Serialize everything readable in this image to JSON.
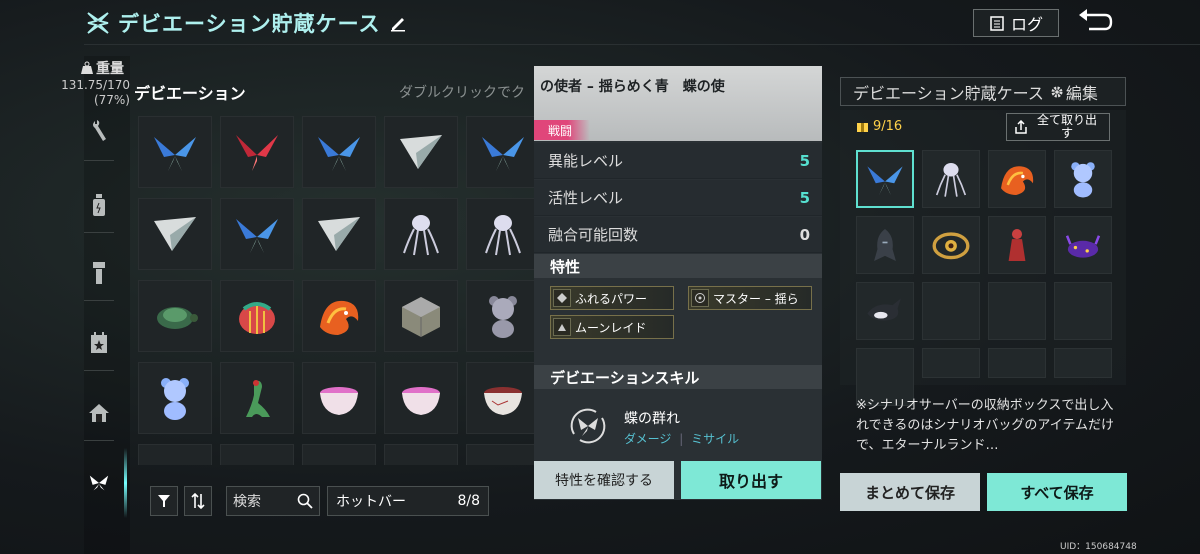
{
  "header": {
    "title": "デビエーション貯蔵ケース",
    "log_label": "ログ"
  },
  "sidebar": {
    "weight_label": "重量",
    "weight_value": "131.75/170",
    "weight_percent": "(77%)"
  },
  "inventory": {
    "section_title": "デビエーション",
    "hint": "ダブルクリックでク",
    "items": [
      "butterfly-blue",
      "butterfly-red",
      "butterfly-blue",
      "paper-plane",
      "butterfly-blue",
      "paper-plane",
      "butterfly-blue",
      "paper-plane",
      "jellyfish",
      "jellyfish",
      "turtle",
      "pumpkin-pot",
      "fire-dragon",
      "cube",
      "teddy-gray",
      "teddy-blue",
      "lizard",
      "bowl-pink",
      "bowl-pink",
      "bowl-cup"
    ]
  },
  "toolbar": {
    "search_label": "検索",
    "hotbar_label": "ホットバー",
    "hotbar_count": "8/8"
  },
  "detail": {
    "name": "の使者 – 揺らめく青　蝶の使",
    "tag": "戦闘",
    "rows": [
      {
        "label": "異能レベル",
        "value": "5"
      },
      {
        "label": "活性レベル",
        "value": "5"
      },
      {
        "label": "融合可能回数",
        "value": "0"
      }
    ],
    "traits_title": "特性",
    "traits": [
      "ふれるパワー",
      "マスター – 揺ら",
      "ムーンレイド"
    ],
    "skill_title": "デビエーションスキル",
    "skill_name": "蝶の群れ",
    "skill_tag1": "ダメージ",
    "skill_tag2": "ミサイル",
    "confirm_label": "特性を確認する",
    "take_label": "取り出す"
  },
  "storage": {
    "title": "デビエーション貯蔵ケース",
    "edit_label": "編集",
    "count": "9/16",
    "take_all_label": "全て取り出す",
    "items": [
      "butterfly-blue",
      "jellyfish",
      "fire-dragon",
      "teddy-blue",
      "dark-bird",
      "golden-ring",
      "red-figure",
      "purple-creature",
      "orca"
    ],
    "note": "※シナリオサーバーの収納ボックスで出し入れできるのはシナリオバッグのアイテムだけで、エターナルランド…",
    "batch_save_label": "まとめて保存",
    "save_all_label": "すべて保存"
  },
  "uid": "UID：150684748",
  "colors": {
    "accent": "#7ee8d6",
    "title": "#aef0ee",
    "combat": "#e0467a",
    "count": "#ffd24a"
  }
}
